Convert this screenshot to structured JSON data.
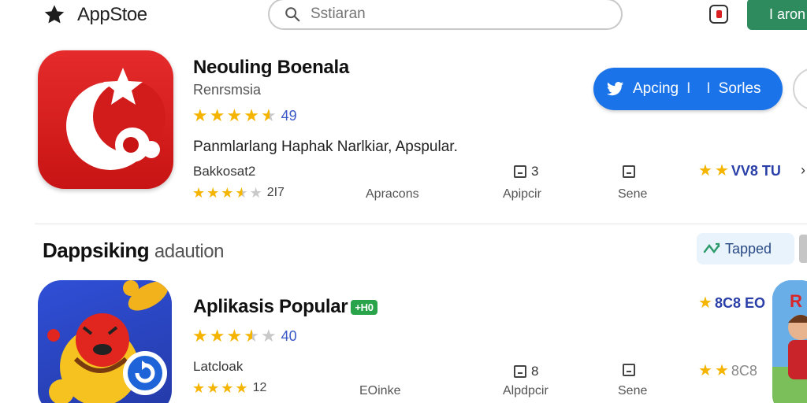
{
  "header": {
    "logo_text": "AppStoe",
    "search_placeholder": "Sstiaran",
    "login_label": "I aron"
  },
  "featured": {
    "title": "Neouling Boenala",
    "subtitle": "Renrsmsia",
    "rating_value": "49",
    "description": "Panmlarlang Haphak Narlkiar, Apspular.",
    "tagline": "Bakkosat2",
    "small_rating_value": "2I7",
    "meta": {
      "category": "Apracons",
      "count": "3",
      "count_label": "Apipcir",
      "share_label": "Sene"
    },
    "side_rating_text": "VV8 TU",
    "action_button": {
      "label_left": "Apcing",
      "separator": "I",
      "label_right": "Sorles"
    }
  },
  "section": {
    "title_bold": "Dappsiking",
    "title_light": "adaution",
    "tapped_label": "Tapped"
  },
  "popular": {
    "title": "Aplikasis Popular",
    "badge": "+H0",
    "rating_value": "40",
    "tagline": "Latcloak",
    "small_rating_value": "12",
    "meta": {
      "category": "EOinke",
      "count": "8",
      "count_label": "Alpdpcir",
      "share_label": "Sene"
    },
    "side_rating_text": "8C8 EO",
    "side_rating_text_2": "8C8",
    "side_icon_text": "R"
  },
  "colors": {
    "accent_blue": "#1a73e8",
    "login_green": "#2e8b5e",
    "star_gold": "#f4b400",
    "icon_red": "#e52b2b"
  }
}
